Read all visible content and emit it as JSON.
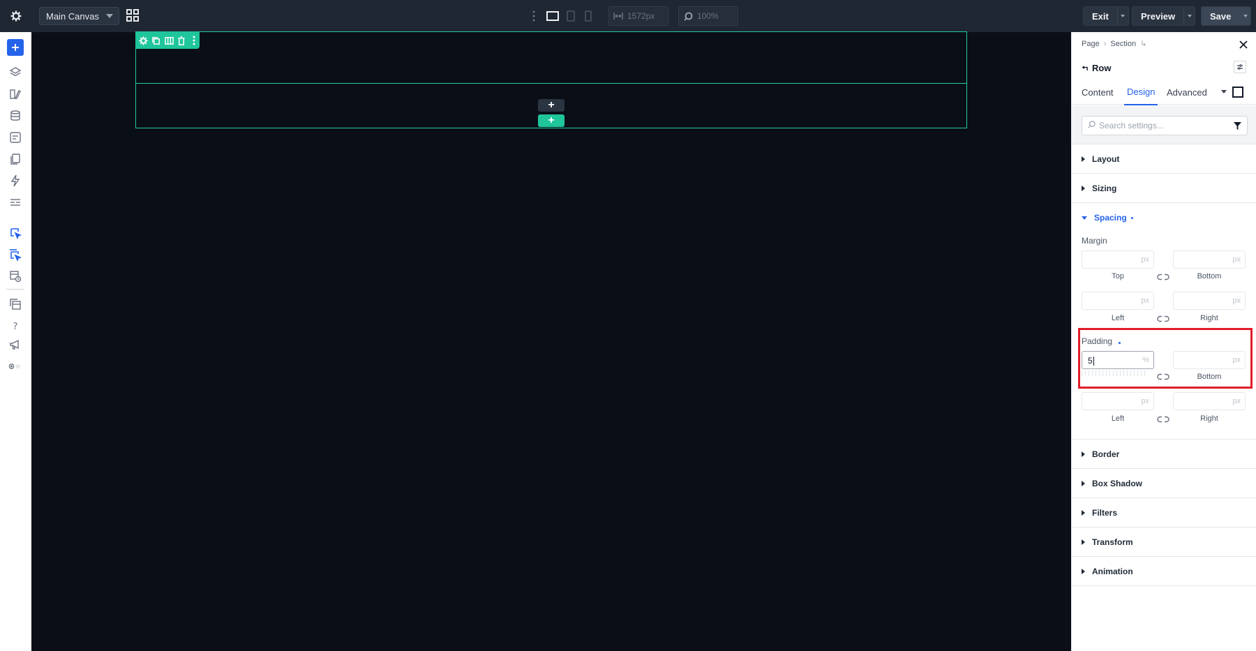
{
  "topbar": {
    "canvas_select": "Main Canvas",
    "width_value": "1572px",
    "zoom_value": "100%",
    "exit_label": "Exit",
    "preview_label": "Preview",
    "save_label": "Save"
  },
  "canvas": {
    "add_button": "+",
    "add_section_button": "+"
  },
  "panel": {
    "breadcrumb": [
      "Page",
      "Section"
    ],
    "title": "Row",
    "tabs": [
      {
        "label": "Content"
      },
      {
        "label": "Design"
      },
      {
        "label": "Advanced"
      }
    ],
    "active_tab": "Design",
    "search_placeholder": "Search settings...",
    "sections_top": [
      "Layout",
      "Sizing"
    ],
    "spacing": {
      "label": "Spacing",
      "margin": {
        "label": "Margin",
        "top_label": "Top",
        "bottom_label": "Bottom",
        "left_label": "Left",
        "right_label": "Right",
        "unit": "px"
      },
      "padding": {
        "label": "Padding",
        "top_value": "5",
        "top_unit": "%",
        "bottom_label": "Bottom",
        "left_label": "Left",
        "right_label": "Right",
        "unit": "px"
      }
    },
    "sections_bottom": [
      "Border",
      "Box Shadow",
      "Filters",
      "Transform",
      "Animation"
    ]
  },
  "colors": {
    "accent": "#2563eb",
    "canvas_bg": "#0a0e17",
    "toolbar_green": "#1fc59b",
    "highlight_red": "#e11d2a"
  }
}
